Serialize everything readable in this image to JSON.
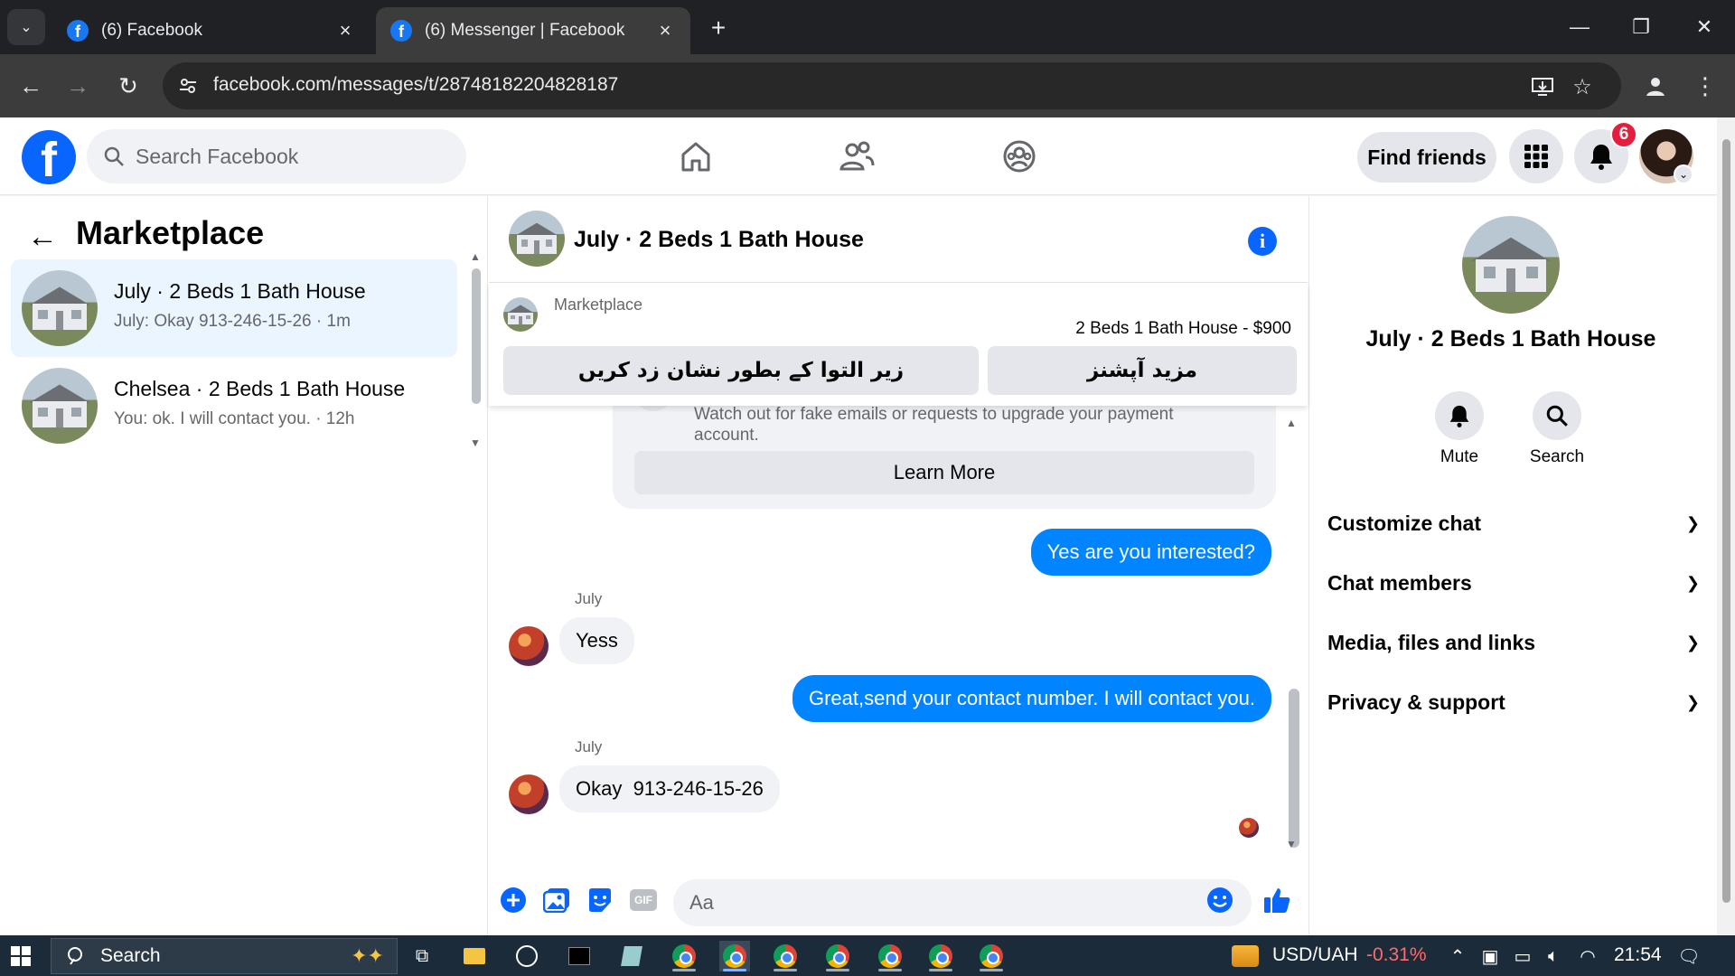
{
  "browser": {
    "tabs": [
      {
        "title": "(6) Facebook",
        "active": false
      },
      {
        "title": "(6) Messenger | Facebook",
        "active": true
      }
    ],
    "url": "facebook.com/messages/t/28748182204828187"
  },
  "fb_header": {
    "search_placeholder": "Search Facebook",
    "find_friends_label": "Find friends",
    "notification_count": "6"
  },
  "left_panel": {
    "title": "Marketplace",
    "conversations": [
      {
        "name": "July · 2 Beds 1 Bath House",
        "preview": "July: Okay  913-246-15-26 · 1m",
        "active": true
      },
      {
        "name": "Chelsea · 2 Beds 1 Bath House",
        "preview": "You: ok. I will contact you. · 12h",
        "active": false
      }
    ]
  },
  "chat": {
    "title": "July · 2 Beds 1 Bath House",
    "marketplace_label": "Marketplace",
    "listing": "2 Beds 1 Bath House - $900",
    "buttons": {
      "mark_pending": "زیر التوا کے بطور نشان زد کریں",
      "more_options": "مزید آپشنز"
    },
    "safety_text": "Watch out for fake emails or requests to upgrade your payment account.",
    "learn_more": "Learn More",
    "messages": [
      {
        "from": "me",
        "text": "Yes are you interested?"
      },
      {
        "from": "July",
        "sender_label": "July",
        "text": "Yess"
      },
      {
        "from": "me",
        "text": "Great,send your  contact number. I will contact you."
      },
      {
        "from": "July",
        "sender_label": "July",
        "text": "Okay  913-246-15-26"
      }
    ],
    "composer_placeholder": "Aa",
    "gif_label": "GIF"
  },
  "right_panel": {
    "title": "July · 2 Beds 1 Bath House",
    "actions": [
      {
        "label": "Mute",
        "icon": "bell-icon"
      },
      {
        "label": "Search",
        "icon": "search-icon"
      }
    ],
    "sections": [
      "Customize chat",
      "Chat members",
      "Media, files and links",
      "Privacy & support"
    ]
  },
  "taskbar": {
    "search_label": "Search",
    "currency_pair": "USD/UAH",
    "currency_change": "-0.31%",
    "time": "21:54"
  },
  "colors": {
    "fb_blue": "#0866ff",
    "messenger_bubble": "#0084ff",
    "negative": "#ff6b6b"
  }
}
